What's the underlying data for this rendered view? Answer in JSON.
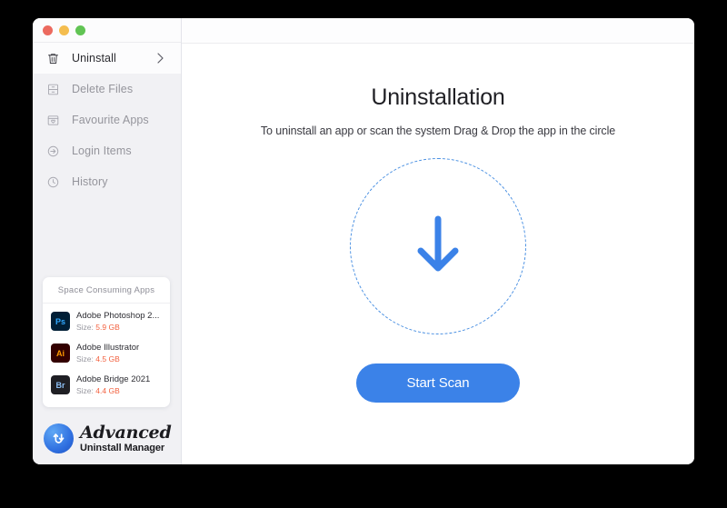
{
  "window": {
    "traffic_lights": [
      {
        "name": "close",
        "color": "#ec6a5f"
      },
      {
        "name": "minimize",
        "color": "#f4bd4f"
      },
      {
        "name": "zoom",
        "color": "#61c454"
      }
    ]
  },
  "sidebar": {
    "items": [
      {
        "label": "Uninstall",
        "icon": "trash-icon",
        "active": true,
        "chevron": true
      },
      {
        "label": "Delete Files",
        "icon": "drawer-icon",
        "active": false,
        "chevron": false
      },
      {
        "label": "Favourite Apps",
        "icon": "window-heart-icon",
        "active": false,
        "chevron": false
      },
      {
        "label": "Login Items",
        "icon": "login-arrow-icon",
        "active": false,
        "chevron": false
      },
      {
        "label": "History",
        "icon": "clock-icon",
        "active": false,
        "chevron": false
      }
    ],
    "space_card": {
      "title": "Space Consuming Apps",
      "size_label": "Size:",
      "apps": [
        {
          "name": "Adobe Photoshop 2...",
          "badge": "Ps",
          "size": "5.9 GB",
          "badge_bg": "#001e36",
          "badge_fg": "#31a8ff"
        },
        {
          "name": "Adobe Illustrator",
          "badge": "Ai",
          "size": "4.5 GB",
          "badge_bg": "#330000",
          "badge_fg": "#ff9a00"
        },
        {
          "name": "Adobe Bridge 2021",
          "badge": "Br",
          "size": "4.4 GB",
          "badge_bg": "#1f1f24",
          "badge_fg": "#8bbdf2"
        }
      ]
    },
    "brand": {
      "title": "Advanced",
      "subtitle": "Uninstall Manager",
      "mark_icon": "uninstall-manager-logo-icon"
    }
  },
  "main": {
    "title": "Uninstallation",
    "subtitle": "To uninstall an app or scan the system Drag & Drop the app in the circle",
    "dropzone": {
      "icon": "download-arrow-icon"
    },
    "start_scan_label": "Start Scan"
  },
  "colors": {
    "accent": "#3b82e8",
    "dashed_circle": "#4a90e2",
    "size_warning": "#f2613f",
    "sidebar_bg": "#f1f1f4",
    "window_bg": "#ffffff"
  }
}
